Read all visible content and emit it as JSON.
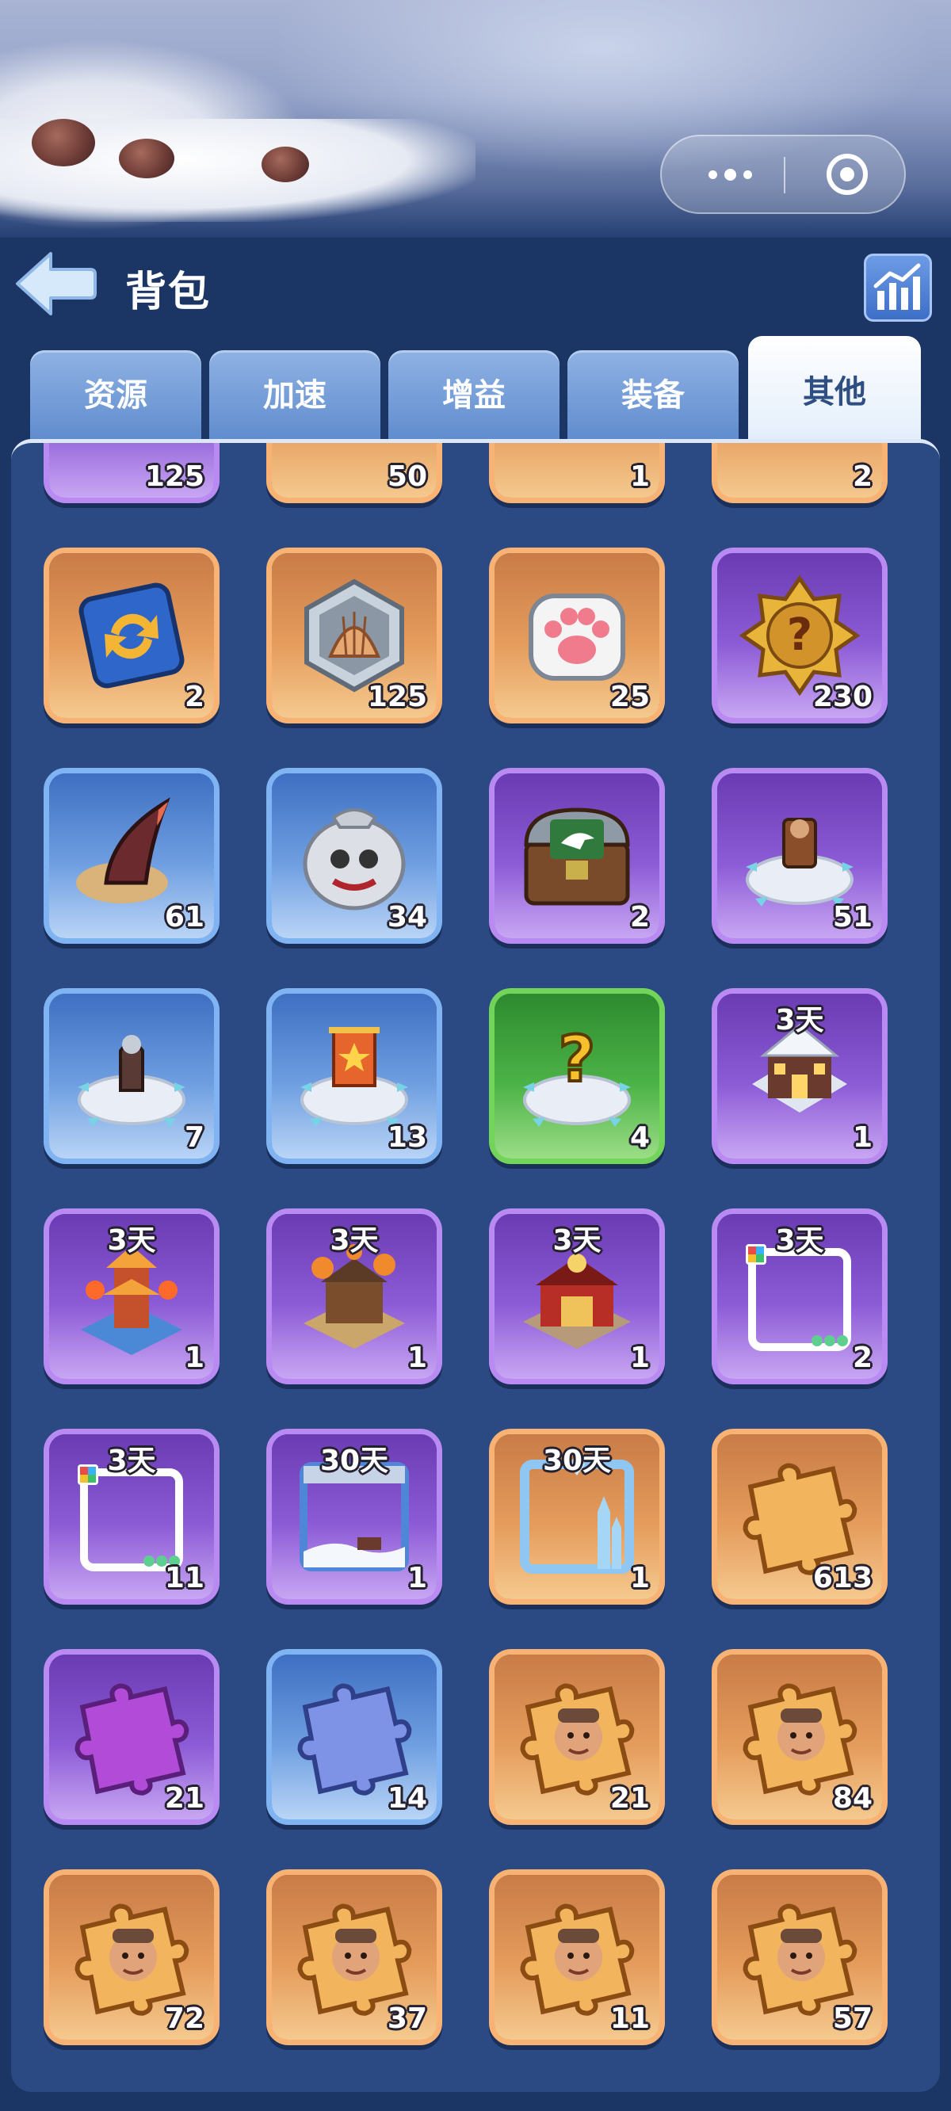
{
  "header": {
    "title": "背包"
  },
  "tabs": [
    {
      "label": "资源",
      "active": false
    },
    {
      "label": "加速",
      "active": false
    },
    {
      "label": "增益",
      "active": false
    },
    {
      "label": "装备",
      "active": false
    },
    {
      "label": "其他",
      "active": true
    }
  ],
  "items": [
    {
      "icon": "partial-item-icon",
      "rarity": "purple",
      "qty": "125",
      "timer": ""
    },
    {
      "icon": "partial-item-icon",
      "rarity": "orange",
      "qty": "50",
      "timer": ""
    },
    {
      "icon": "partial-item-icon",
      "rarity": "orange",
      "qty": "1",
      "timer": ""
    },
    {
      "icon": "partial-item-icon",
      "rarity": "orange",
      "qty": "2",
      "timer": ""
    },
    {
      "icon": "swap-card-icon",
      "rarity": "orange",
      "qty": "2",
      "timer": ""
    },
    {
      "icon": "shell-token-icon",
      "rarity": "orange",
      "qty": "125",
      "timer": ""
    },
    {
      "icon": "paw-token-icon",
      "rarity": "orange",
      "qty": "25",
      "timer": ""
    },
    {
      "icon": "mystery-gold-badge-icon",
      "rarity": "purple",
      "qty": "230",
      "timer": ""
    },
    {
      "icon": "horn-icon",
      "rarity": "blue",
      "qty": "61",
      "timer": ""
    },
    {
      "icon": "skull-sack-icon",
      "rarity": "blue",
      "qty": "34",
      "timer": ""
    },
    {
      "icon": "eagle-chest-icon",
      "rarity": "purple",
      "qty": "2",
      "timer": ""
    },
    {
      "icon": "throne-relocation-icon",
      "rarity": "purple",
      "qty": "51",
      "timer": ""
    },
    {
      "icon": "statue-relocation-icon",
      "rarity": "blue",
      "qty": "7",
      "timer": ""
    },
    {
      "icon": "banner-relocation-icon",
      "rarity": "blue",
      "qty": "13",
      "timer": ""
    },
    {
      "icon": "random-relocation-icon",
      "rarity": "green",
      "qty": "4",
      "timer": ""
    },
    {
      "icon": "winter-house-skin-icon",
      "rarity": "purple",
      "qty": "1",
      "timer": "3天"
    },
    {
      "icon": "lantern-tower-skin-icon",
      "rarity": "purple",
      "qty": "1",
      "timer": "3天"
    },
    {
      "icon": "festival-house-skin-icon",
      "rarity": "purple",
      "qty": "1",
      "timer": "3天"
    },
    {
      "icon": "red-palace-skin-icon",
      "rarity": "purple",
      "qty": "1",
      "timer": "3天"
    },
    {
      "icon": "avatar-frame-icon",
      "rarity": "purple",
      "qty": "2",
      "timer": "3天"
    },
    {
      "icon": "avatar-frame-icon",
      "rarity": "purple",
      "qty": "11",
      "timer": "3天"
    },
    {
      "icon": "snow-frame-icon",
      "rarity": "purple",
      "qty": "1",
      "timer": "30天"
    },
    {
      "icon": "ice-castle-frame-icon",
      "rarity": "orange",
      "qty": "1",
      "timer": "30天"
    },
    {
      "icon": "orange-puzzle-icon",
      "rarity": "orange",
      "qty": "613",
      "timer": ""
    },
    {
      "icon": "purple-puzzle-icon",
      "rarity": "purple",
      "qty": "21",
      "timer": ""
    },
    {
      "icon": "blue-puzzle-icon",
      "rarity": "blue",
      "qty": "14",
      "timer": ""
    },
    {
      "icon": "hero-puzzle-icon",
      "rarity": "orange",
      "qty": "21",
      "timer": ""
    },
    {
      "icon": "hero-puzzle-icon",
      "rarity": "orange",
      "qty": "84",
      "timer": ""
    },
    {
      "icon": "hero-puzzle-icon",
      "rarity": "orange",
      "qty": "72",
      "timer": ""
    },
    {
      "icon": "hero-puzzle-icon",
      "rarity": "orange",
      "qty": "37",
      "timer": ""
    },
    {
      "icon": "hero-puzzle-icon",
      "rarity": "orange",
      "qty": "11",
      "timer": ""
    },
    {
      "icon": "hero-puzzle-icon",
      "rarity": "orange",
      "qty": "57",
      "timer": ""
    }
  ]
}
